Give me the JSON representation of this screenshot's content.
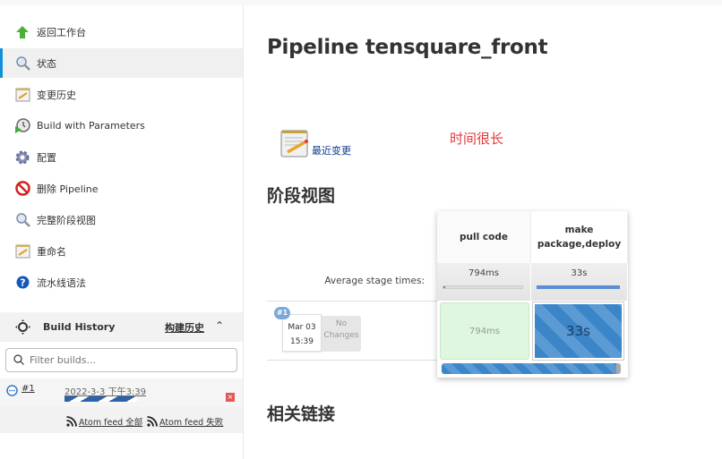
{
  "sidebar": {
    "items": [
      {
        "label": "返回工作台",
        "icon": "up-arrow-icon"
      },
      {
        "label": "状态",
        "icon": "search-icon",
        "active": true
      },
      {
        "label": "变更历史",
        "icon": "notepad-icon"
      },
      {
        "label": "Build with Parameters",
        "icon": "clock-play-icon"
      },
      {
        "label": "配置",
        "icon": "gear-icon"
      },
      {
        "label": "删除 Pipeline",
        "icon": "no-entry-icon"
      },
      {
        "label": "完整阶段视图",
        "icon": "search-icon"
      },
      {
        "label": "重命名",
        "icon": "notepad-icon"
      },
      {
        "label": "流水线语法",
        "icon": "help-icon"
      }
    ]
  },
  "build_history": {
    "title": "Build History",
    "link": "构建历史",
    "filter_placeholder": "Filter builds...",
    "builds": [
      {
        "number": "#1",
        "date": "2022-3-3 下午3:39",
        "status": "running"
      }
    ],
    "feeds": [
      {
        "label": "Atom feed 全部"
      },
      {
        "label": "Atom feed 失败"
      }
    ]
  },
  "main": {
    "title": "Pipeline tensquare_front",
    "recent_changes": "最近变更",
    "note": "时间很长",
    "stage_view_heading": "阶段视图",
    "related_links_heading": "相关链接",
    "stage_view": {
      "avg_label": "Average stage times:",
      "stages": [
        {
          "name": "pull code",
          "avg": "794ms",
          "avg_fraction": 0.02
        },
        {
          "name": "make package,deploy",
          "name_line1": "make",
          "name_line2": "package,deploy",
          "avg": "33s",
          "avg_fraction": 1.0
        }
      ],
      "runs": [
        {
          "badge": "#1",
          "date": "Mar 03",
          "time": "15:39",
          "changes": "No Changes",
          "changes_line1": "No",
          "changes_line2": "Changes",
          "cells": [
            {
              "value": "794ms",
              "status": "success"
            },
            {
              "value": "33s",
              "status": "running"
            }
          ]
        }
      ]
    }
  }
}
